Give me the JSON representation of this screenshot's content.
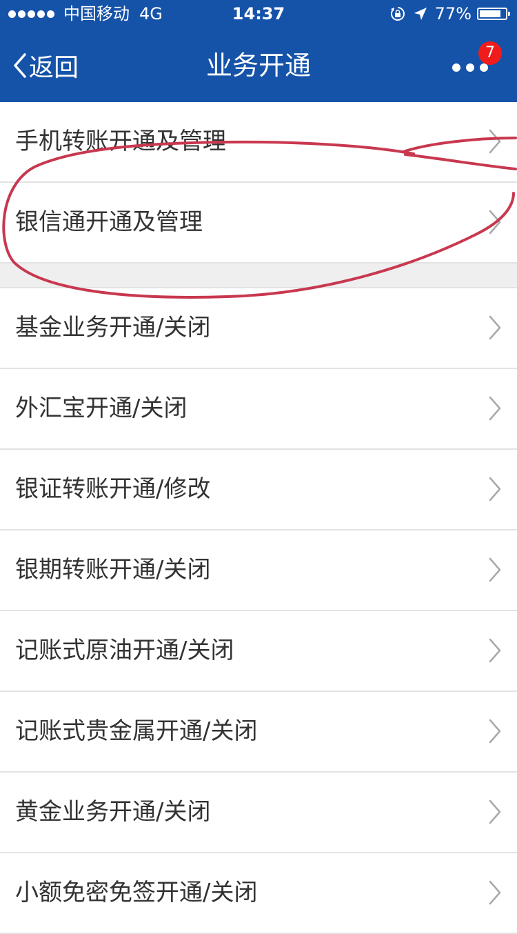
{
  "status_bar": {
    "carrier": "中国移动",
    "network": "4G",
    "time": "14:37",
    "battery": "77%"
  },
  "nav": {
    "back_label": "返回",
    "title": "业务开通",
    "badge_count": "7"
  },
  "group1": [
    {
      "label": "手机转账开通及管理"
    },
    {
      "label": "银信通开通及管理"
    }
  ],
  "group2": [
    {
      "label": "基金业务开通/关闭"
    },
    {
      "label": "外汇宝开通/关闭"
    },
    {
      "label": "银证转账开通/修改"
    },
    {
      "label": "银期转账开通/关闭"
    },
    {
      "label": "记账式原油开通/关闭"
    },
    {
      "label": "记账式贵金属开通/关闭"
    },
    {
      "label": "黄金业务开通/关闭"
    },
    {
      "label": "小额免密免签开通/关闭"
    }
  ],
  "colors": {
    "header": "#1553a9",
    "badge": "#f01c1c",
    "annotation": "#c8384f"
  },
  "icons": {
    "back": "chevron-left-icon",
    "more": "more-dots-icon",
    "row": "chevron-right-icon"
  }
}
